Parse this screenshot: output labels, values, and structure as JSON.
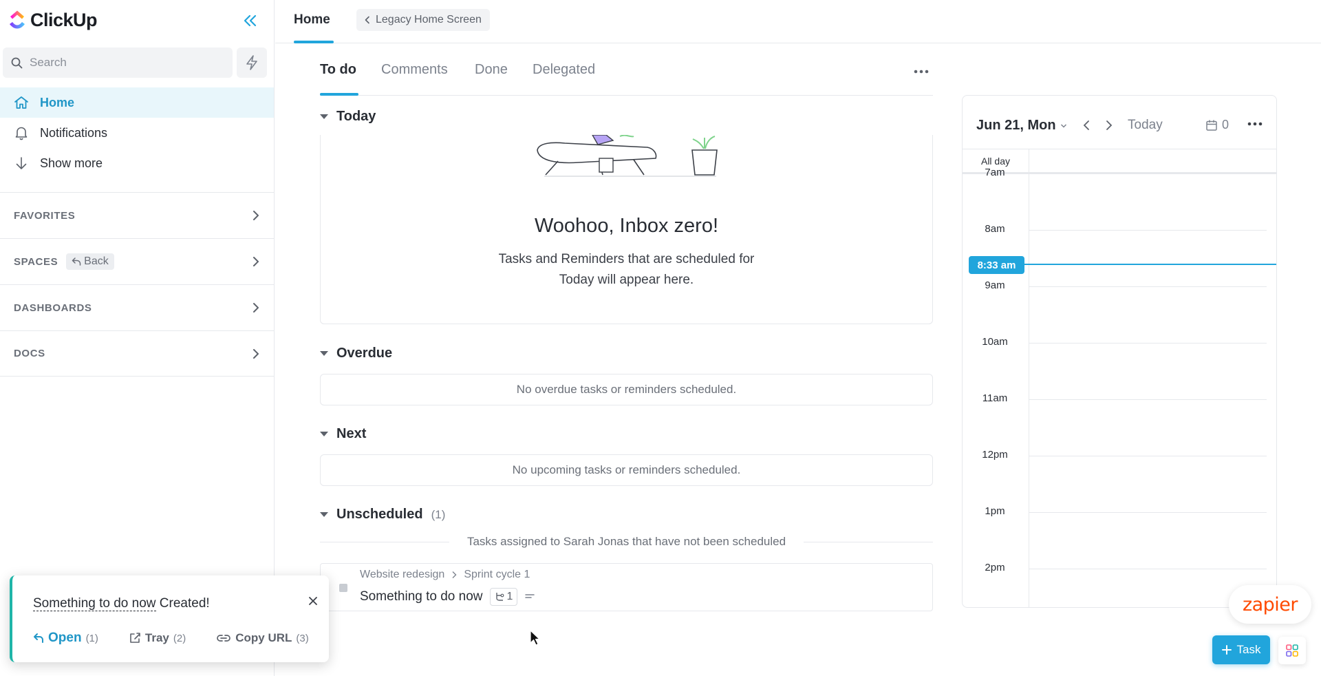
{
  "brand": {
    "name": "ClickUp"
  },
  "sidebar": {
    "search_placeholder": "Search",
    "nav": [
      {
        "label": "Home",
        "icon": "home-icon",
        "active": true
      },
      {
        "label": "Notifications",
        "icon": "bell-icon",
        "active": false
      },
      {
        "label": "Show more",
        "icon": "arrow-down-icon",
        "active": false
      }
    ],
    "sections": {
      "favorites": "FAVORITES",
      "spaces": "SPACES",
      "spaces_back": "Back",
      "dashboards": "DASHBOARDS",
      "docs": "DOCS"
    }
  },
  "header": {
    "tab": "Home",
    "legacy_button": "Legacy Home Screen"
  },
  "tabs": [
    "To do",
    "Comments",
    "Done",
    "Delegated"
  ],
  "groups": {
    "today": {
      "label": "Today",
      "empty_title": "Woohoo, Inbox zero!",
      "empty_line1": "Tasks and Reminders that are scheduled for",
      "empty_line2": "Today will appear here."
    },
    "overdue": {
      "label": "Overdue",
      "empty": "No overdue tasks or reminders scheduled."
    },
    "next": {
      "label": "Next",
      "empty": "No upcoming tasks or reminders scheduled."
    },
    "unscheduled": {
      "label": "Unscheduled",
      "count": "(1)",
      "note": "Tasks assigned to Sarah Jonas that have not been scheduled"
    }
  },
  "task": {
    "list": "Website redesign",
    "folder": "Sprint cycle 1",
    "name": "Something to do now",
    "subtasks": "1"
  },
  "calendar": {
    "date": "Jun 21, Mon",
    "today": "Today",
    "count": "0",
    "all_day": "All day",
    "now": "8:33 am",
    "hours": [
      "7am",
      "8am",
      "9am",
      "10am",
      "11am",
      "12pm",
      "1pm",
      "2pm"
    ]
  },
  "toast": {
    "task_name": "Something to do now",
    "status": "Created!",
    "actions": [
      {
        "label": "Open",
        "key": "(1)"
      },
      {
        "label": "Tray",
        "key": "(2)"
      },
      {
        "label": "Copy URL",
        "key": "(3)"
      }
    ]
  },
  "fab": {
    "task_label": "Task"
  },
  "zapier": {
    "label": "zapier"
  },
  "colors": {
    "accent": "#21a5dc",
    "brand_orange": "#ff4a00",
    "toast_accent": "#1fb5a8"
  }
}
